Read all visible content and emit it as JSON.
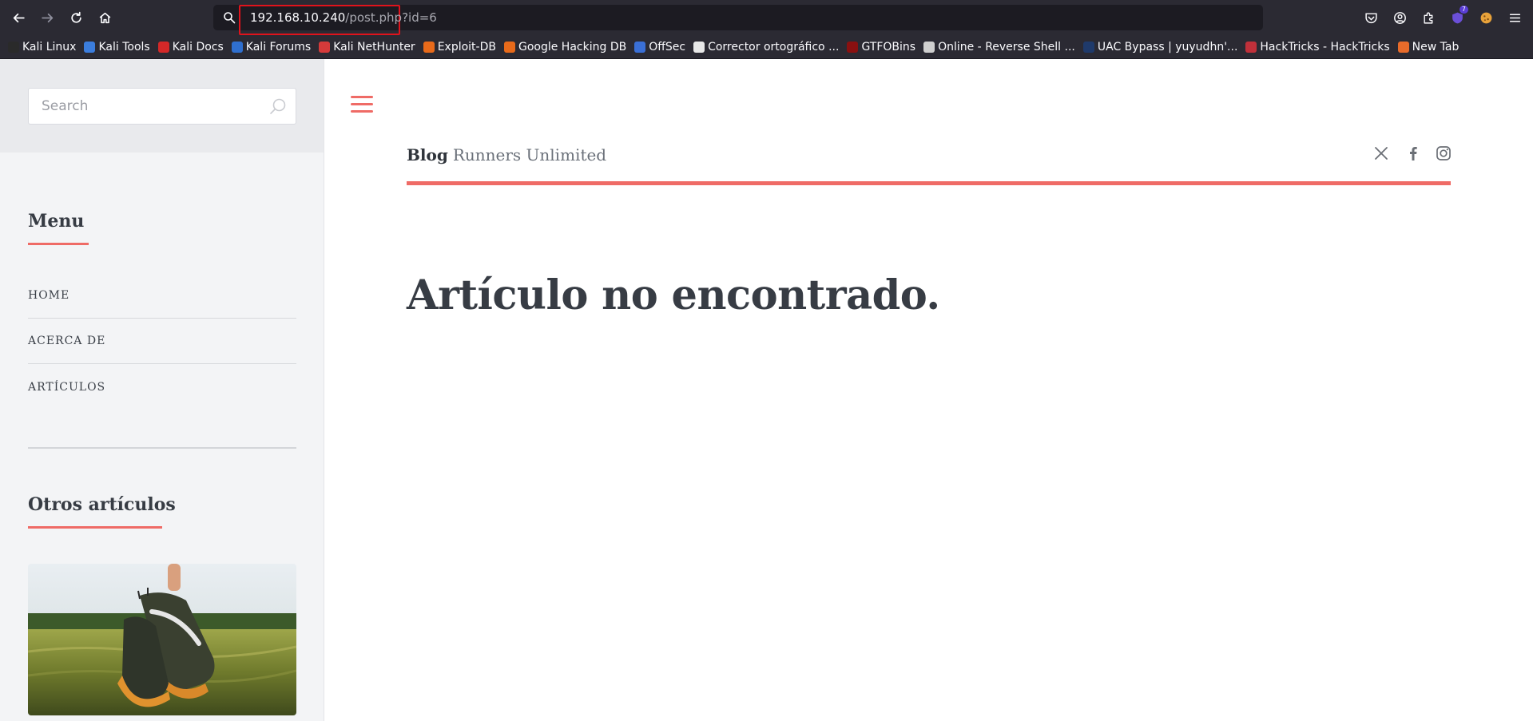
{
  "browser": {
    "url_host": "192.168.10.240",
    "url_path": "/post.php?id=6",
    "extension_badge": "7",
    "bookmarks": [
      {
        "label": "Kali Linux",
        "color": "#2a2a2a"
      },
      {
        "label": "Kali Tools",
        "color": "#3b7ddd"
      },
      {
        "label": "Kali Docs",
        "color": "#d42828"
      },
      {
        "label": "Kali Forums",
        "color": "#2f6fcf"
      },
      {
        "label": "Kali NetHunter",
        "color": "#d63a3a"
      },
      {
        "label": "Exploit-DB",
        "color": "#e86a1a"
      },
      {
        "label": "Google Hacking DB",
        "color": "#e86a1a"
      },
      {
        "label": "OffSec",
        "color": "#3a6fd6"
      },
      {
        "label": "Corrector ortográfico ...",
        "color": "#e8e8e8"
      },
      {
        "label": "GTFOBins",
        "color": "#8a1010"
      },
      {
        "label": "Online - Reverse Shell ...",
        "color": "#cfcfcf"
      },
      {
        "label": "UAC Bypass | yuyudhn'...",
        "color": "#1f3a6b"
      },
      {
        "label": "HackTricks - HackTricks",
        "color": "#c0303a"
      },
      {
        "label": "New Tab",
        "color": "#e86b2a"
      }
    ]
  },
  "sidebar": {
    "search_placeholder": "Search",
    "menu_title": "Menu",
    "menu_items": [
      "HOME",
      "ACERCA DE",
      "ARTÍCULOS"
    ],
    "other_title": "Otros artículos"
  },
  "main": {
    "brand_bold": "Blog",
    "brand_rest": "Runners Unlimited",
    "message": "Artículo no encontrado."
  },
  "colors": {
    "accent": "#ef6b66",
    "url_highlight": "#e0131c",
    "chrome_bg": "#2b2a33"
  }
}
